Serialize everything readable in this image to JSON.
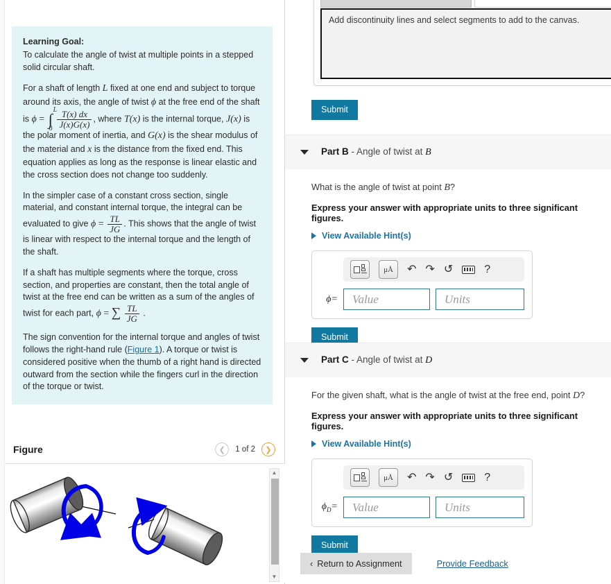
{
  "left": {
    "goal": {
      "title": "Learning Goal:",
      "intro": "To calculate the angle of twist at multiple points in a stepped solid circular shaft.",
      "p2_a": "For a shaft of length",
      "p2_L": "L",
      "p2_b": "fixed at one end and subject to torque around its axis, the angle of twist",
      "p2_phi": "ϕ",
      "p2_c": "at the free end of the shaft is",
      "eq1_phi": "ϕ",
      "eq1_eq": "=",
      "eq1_int": "∫",
      "eq1_upper": "L",
      "eq1_lower": "0",
      "eq1_num": "T(x) dx",
      "eq1_den": "J(x)G(x)",
      "p2_d": ", where",
      "p2_T": "T(x)",
      "p2_e": "is the internal torque,",
      "p2_J": "J(x)",
      "p2_f": "is the",
      "p3": "polar moment of inertia, and",
      "p3_G": "G(x)",
      "p3_b": "is the shear modulus of the material and",
      "p3_x": "x",
      "p3_c": "is the distance from the fixed end. This equation applies as long as the response is linear elastic and the cross section does not change too suddenly.",
      "p4_a": "In the simpler case of a constant cross section, single material, and constant internal torque, the integral can be evaluated to give",
      "eq2_phi": "ϕ",
      "eq2_eq": "=",
      "eq2_num": "TL",
      "eq2_den": "JG",
      "p4_b": ". This shows that the angle of twist is linear with respect to the internal torque and the length of the shaft.",
      "p5_a": "If a shaft has multiple segments where the torque, cross section, and properties are constant, then the total angle of twist at the free end can be written as a sum of the angles of twist for each part,",
      "eq3_phi": "ϕ",
      "eq3_eq": "=",
      "eq3_sigma": "∑",
      "eq3_num": "TL",
      "eq3_den": "JG",
      "eq3_dot": ".",
      "p6_a": "The sign convention for the internal torque and angles of twist follows the right-hand rule (",
      "p6_link": "Figure 1",
      "p6_b": "). A torque or twist is considered positive when the thumb of a right hand is directed outward from the section while the fingers curl in the direction of the torque or twist."
    },
    "figure": {
      "title": "Figure",
      "prev_icon": "chevron-left",
      "next_icon": "chevron-right",
      "counter": "1 of 2",
      "scroll_up_icon": "▲",
      "scroll_down_icon": "▼"
    }
  },
  "right": {
    "canvas_widget": {
      "instruction": "Add discontinuity lines and select segments to add to the canvas."
    },
    "submit_a_label": "Submit",
    "parts": [
      {
        "id": "part-b",
        "caret_icon": "caret-down",
        "title": "Part B",
        "dash": " - ",
        "subtitle_a": "Angle of twist at ",
        "subtitle_var": "B",
        "question_a": "What is the angle of twist at point ",
        "question_var": "B",
        "question_b": "?",
        "instruction": "Express your answer with appropriate units to three significant figures.",
        "hint_label": "View Available Hint(s)",
        "answer_label": "ϕ",
        "answer_sub": "",
        "answer_eq": "=",
        "value_placeholder": "Value",
        "units_placeholder": "Units",
        "submit_label": "Submit"
      },
      {
        "id": "part-c",
        "caret_icon": "caret-down",
        "title": "Part C",
        "dash": " - ",
        "subtitle_a": "Angle of twist at ",
        "subtitle_var": "D",
        "question_a": "For the given shaft, what is the angle of twist at the free end, point ",
        "question_var": "D",
        "question_b": "?",
        "instruction": "Express your answer with appropriate units to three significant figures.",
        "hint_label": "View Available Hint(s)",
        "answer_label": "ϕ",
        "answer_sub": "D",
        "answer_eq": "=",
        "value_placeholder": "Value",
        "units_placeholder": "Units",
        "submit_label": "Submit"
      }
    ],
    "toolbar": {
      "template_icon": "math-template-icon",
      "units_icon": "μÅ",
      "undo_icon": "↶",
      "redo_icon": "↷",
      "reset_icon": "↺",
      "keyboard_icon": "keyboard-icon",
      "help_icon": "?"
    },
    "footer": {
      "return_icon": "‹",
      "return_label": "Return to Assignment",
      "feedback_label": "Provide Feedback"
    }
  },
  "colors": {
    "accent_teal": "#11789f",
    "goal_panel": "#e3f4f6",
    "link_blue": "#1b74a8",
    "figure_arrow": "#0000e6"
  }
}
